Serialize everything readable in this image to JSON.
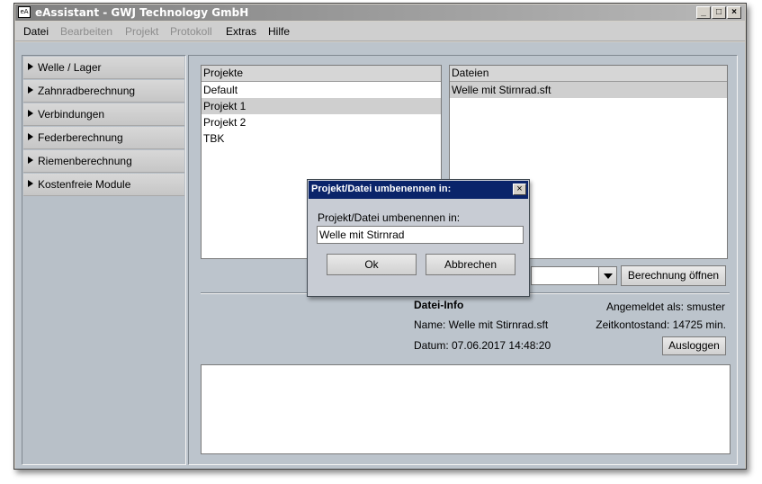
{
  "window": {
    "title": "eAssistant - GWJ Technology GmbH",
    "icon_text": "eA",
    "minimize": "_",
    "maximize": "□",
    "close": "×"
  },
  "menubar": {
    "items": [
      {
        "label": "Datei",
        "enabled": true
      },
      {
        "label": "Bearbeiten",
        "enabled": false
      },
      {
        "label": "Projekt",
        "enabled": false
      },
      {
        "label": "Protokoll",
        "enabled": false
      },
      {
        "label": "Extras",
        "enabled": true
      },
      {
        "label": "Hilfe",
        "enabled": true
      }
    ]
  },
  "sidebar": {
    "items": [
      {
        "label": "Welle / Lager"
      },
      {
        "label": "Zahnradberechnung"
      },
      {
        "label": "Verbindungen"
      },
      {
        "label": "Federberechnung"
      },
      {
        "label": "Riemenberechnung"
      },
      {
        "label": "Kostenfreie Module"
      }
    ]
  },
  "projects": {
    "header": "Projekte",
    "items": [
      "Default",
      "Projekt 1",
      "Projekt 2",
      "TBK"
    ],
    "selected_index": 1
  },
  "files": {
    "header": "Dateien",
    "items": [
      "Welle mit Stirnrad.sft"
    ],
    "selected_index": 0
  },
  "calc": {
    "dropdown_value": "",
    "open_button": "Berechnung öffnen"
  },
  "info": {
    "title": "Datei-Info",
    "name": "Name: Welle mit Stirnrad.sft",
    "date": "Datum: 07.06.2017 14:48:20",
    "logged_in": "Angemeldet als: smuster",
    "time_balance": "Zeitkontostand: 14725 min.",
    "logout_button": "Ausloggen"
  },
  "dialog": {
    "title": "Projekt/Datei umbenennen in:",
    "label": "Projekt/Datei umbenennen in:",
    "input_value": "Welle mit Stirnrad",
    "ok_button": "Ok",
    "cancel_button": "Abbrechen",
    "close": "×"
  },
  "colors": {
    "titlebar_inactive": "#7f7f7f",
    "dialog_titlebar": "#0a246a",
    "panel_bg": "#bcc4cc"
  }
}
